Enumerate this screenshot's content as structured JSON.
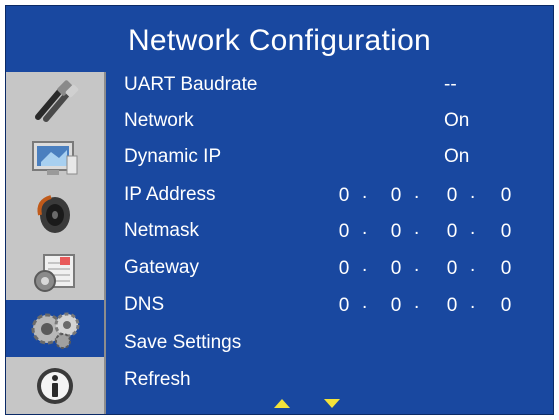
{
  "title": "Network Configuration",
  "sidebar": {
    "items": [
      {
        "icon": "cable-connector-icon"
      },
      {
        "icon": "monitor-display-icon"
      },
      {
        "icon": "speaker-audio-icon"
      },
      {
        "icon": "calendar-schedule-icon"
      },
      {
        "icon": "gears-settings-icon",
        "selected": true
      },
      {
        "icon": "info-icon"
      }
    ]
  },
  "menu": {
    "uart_baudrate": {
      "label": "UART Baudrate",
      "value": "--"
    },
    "network": {
      "label": "Network",
      "value": "On"
    },
    "dynamic_ip": {
      "label": "Dynamic IP",
      "value": "On"
    },
    "ip_address": {
      "label": "IP Address",
      "octets": [
        "0",
        "0",
        "0",
        "0"
      ]
    },
    "netmask": {
      "label": "Netmask",
      "octets": [
        "0",
        "0",
        "0",
        "0"
      ]
    },
    "gateway": {
      "label": "Gateway",
      "octets": [
        "0",
        "0",
        "0",
        "0"
      ]
    },
    "dns": {
      "label": "DNS",
      "octets": [
        "0",
        "0",
        "0",
        "0"
      ]
    },
    "save_settings": {
      "label": "Save Settings"
    },
    "refresh": {
      "label": "Refresh"
    }
  },
  "colors": {
    "panel": "#1948a0",
    "sidebar": "#c6c6c6",
    "arrow": "#f3e33a",
    "text": "#ffffff"
  }
}
